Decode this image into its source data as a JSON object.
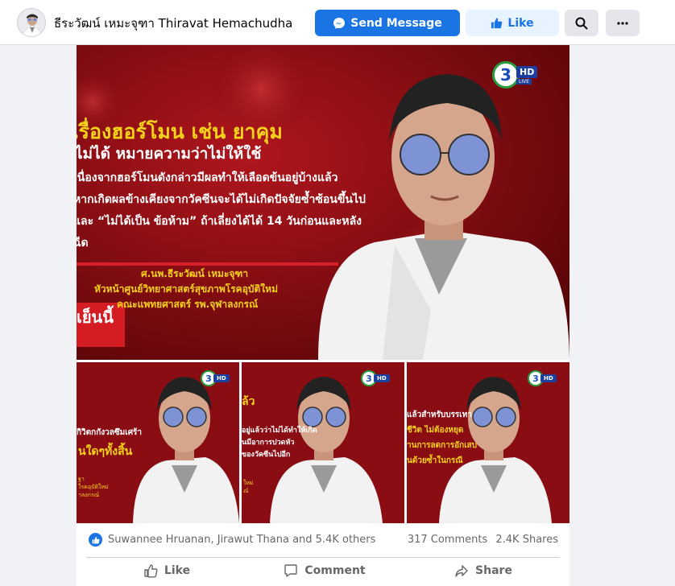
{
  "header": {
    "page_name": "ธีระวัฒน์ เหมะจุฑา Thiravat Hemachudha",
    "send_message_label": "Send Message",
    "like_label": "Like",
    "search_icon": "search-icon",
    "more_icon": "more-dots-icon"
  },
  "post": {
    "main_image": {
      "channel_badge": "3",
      "hd_badge": "HD",
      "live_badge": "LIVE",
      "headline": "เรื่องฮอร์โมน เช่น ยาคุม",
      "subheadline": "ไม่ได้ หมายความว่าไม่ให้ใช้",
      "body_lines": [
        "เนื่องจากฮอร์โมนดังกล่าวมีผลทำให้เลือดข้นอยู่บ้างแล้ว",
        "หากเกิดผลข้างเคียงจากวัคซีนจะได้ไม่เกิดปัจจัยซ้ำซ้อนขึ้นไป",
        "และ “ไม่ได้เป็น ข้อห้าม” ถ้าเลี่ยงได้ได้ 14 วันก่อนและหลัง",
        "ฉีด"
      ],
      "caption_name": "ศ.นพ.ธีระวัฒน์ เหมะจุฑา",
      "caption_lines": [
        "หัวหน้าศูนย์วิทยาศาสตร์สุขภาพโรคอุบัติใหม่",
        "คณะแพทยศาสตร์ รพ.จุฬาลงกรณ์"
      ],
      "tag": "เย็นนี้"
    },
    "thumbnails": [
      {
        "channel_badge": "3",
        "hd_badge": "HD",
        "lines": [
          "กิวิตกกังวลซึมเศร้า",
          "นใดๆทั้งสิ้น"
        ],
        "caption": [
          "ฐา",
          "ใรคอุบัติใหม่",
          "าลงกรณ์"
        ]
      },
      {
        "channel_badge": "3",
        "hd_badge": "HD",
        "lines": [
          "ล้ว",
          "อยู่แล้วว่าไม่ได้ทำให้เกิด",
          "นมีอาการปวดหัว",
          "ของวัคซีนไปอีก"
        ],
        "caption": [
          "ใหม่",
          "ณ์"
        ]
      },
      {
        "channel_badge": "3",
        "hd_badge": "HD",
        "lines": [
          "แล้วสำหรับบรรเทา",
          "ชีวิต ไม่ต้องหยุด",
          "านการลดการอักเสบ",
          "นด้วยซ้ำในกรณี"
        ],
        "caption": []
      }
    ],
    "reactions": {
      "reaction_icon": "thumbs-up-icon",
      "text": "Suwannee Hruanan, Jirawut Thana and 5.4K others",
      "comments": "317 Comments",
      "shares": "2.4K Shares"
    },
    "actions": {
      "like_label": "Like",
      "comment_label": "Comment",
      "share_label": "Share"
    }
  },
  "colors": {
    "primary_blue": "#1b74e4",
    "light_blue": "#e7f3ff",
    "gray_button": "#e4e6eb",
    "tv_red": "#8e0f16",
    "headline_yellow": "#f4d21b"
  }
}
